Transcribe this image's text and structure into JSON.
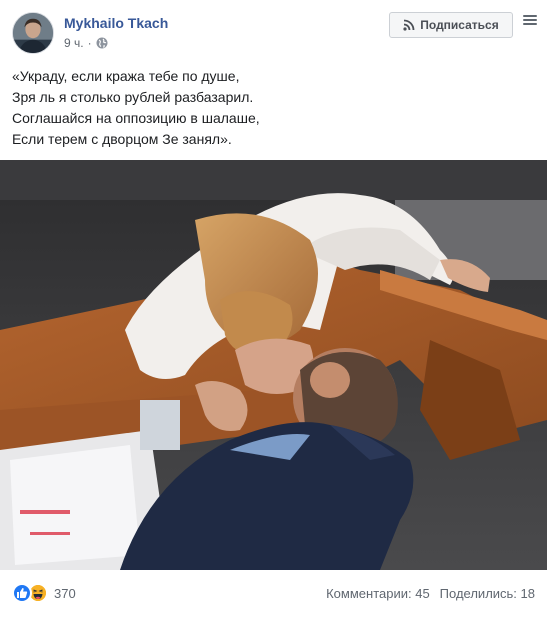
{
  "author": {
    "name": "Mykhailo Tkach",
    "time": "9 ч.",
    "dot": "·"
  },
  "follow_button": {
    "label": "Подписаться"
  },
  "post": {
    "lines": [
      "«Украду, если кража тебе по душе,",
      "Зря ль я столько рублей разбазарил.",
      "Соглашайся на оппозицию в шалаше,",
      "Если терем с дворцом Зе занял»."
    ]
  },
  "reactions": {
    "count": "370",
    "icons": [
      "like-icon",
      "haha-icon"
    ]
  },
  "stats": {
    "comments": "Комментарии: 45",
    "shares": "Поделились: 18"
  },
  "colors": {
    "author_link": "#385898",
    "like": "#2078f4",
    "haha": "#f7b125",
    "muted": "#606770"
  }
}
